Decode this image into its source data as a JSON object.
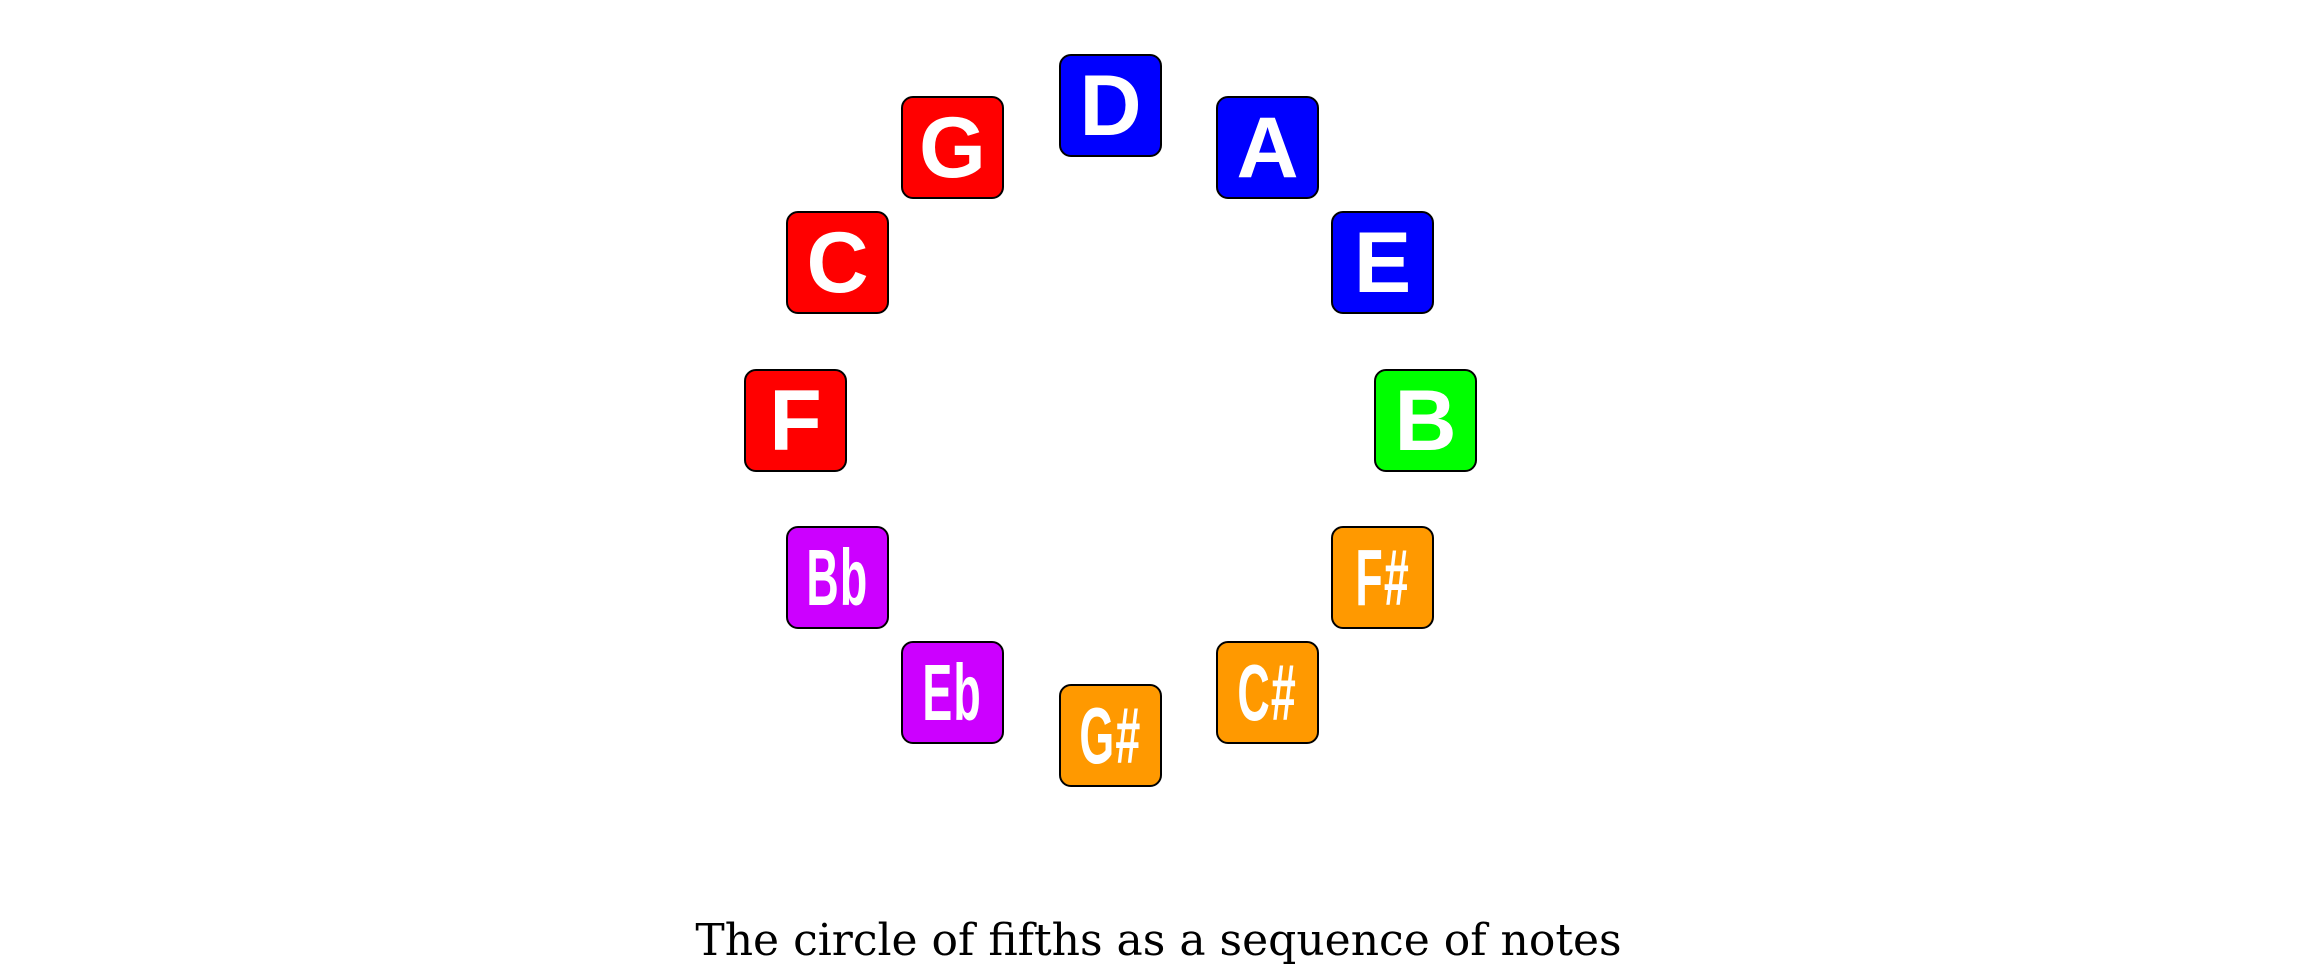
{
  "colors": {
    "red": "#ff0000",
    "blue": "#0000ff",
    "green": "#00ff00",
    "orange": "#ff9900",
    "purple": "#cc00ff",
    "outline": "#000000",
    "text": "#ffffff"
  },
  "notes": [
    {
      "label": "D",
      "color": "#0000ff"
    },
    {
      "label": "A",
      "color": "#0000ff"
    },
    {
      "label": "E",
      "color": "#0000ff"
    },
    {
      "label": "B",
      "color": "#00ff00"
    },
    {
      "label": "F#",
      "color": "#ff9900"
    },
    {
      "label": "C#",
      "color": "#ff9900"
    },
    {
      "label": "G#",
      "color": "#ff9900"
    },
    {
      "label": "Eb",
      "color": "#cc00ff"
    },
    {
      "label": "Bb",
      "color": "#cc00ff"
    },
    {
      "label": "F",
      "color": "#ff0000"
    },
    {
      "label": "C",
      "color": "#ff0000"
    },
    {
      "label": "G",
      "color": "#ff0000"
    }
  ],
  "caption": "The circle of fifths as a sequence of notes"
}
